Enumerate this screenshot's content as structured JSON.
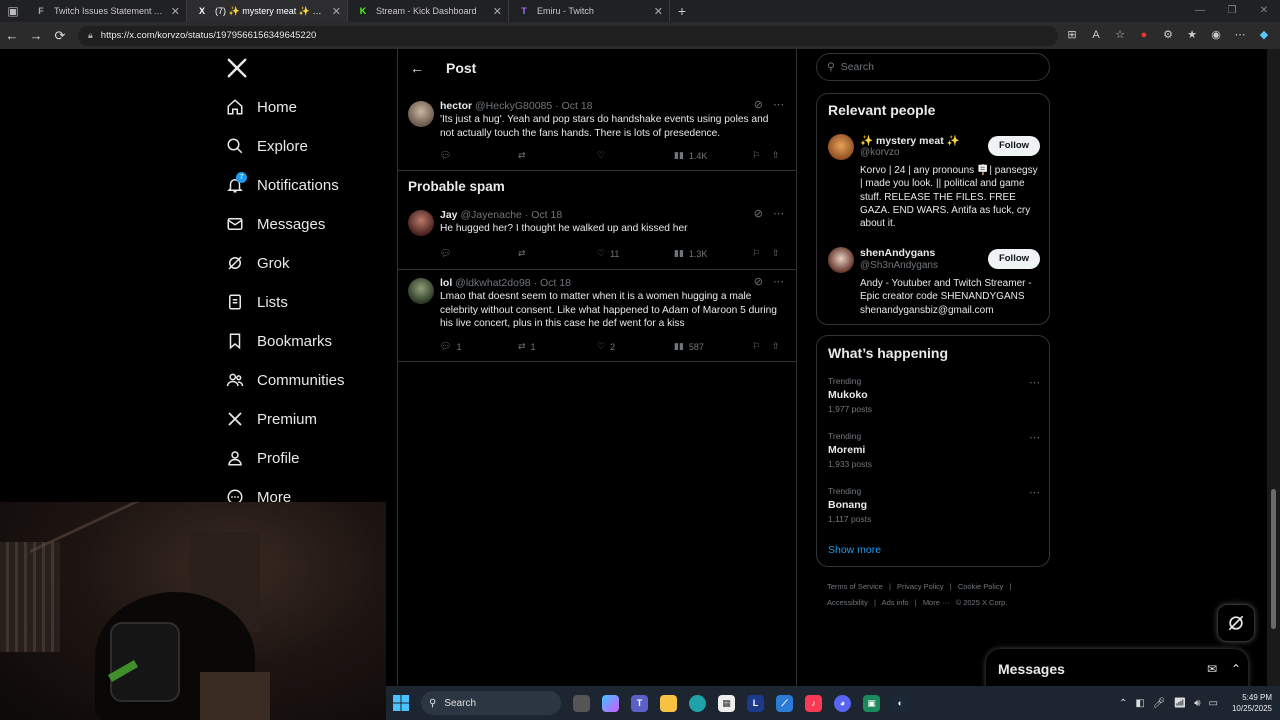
{
  "browser": {
    "tabs": [
      {
        "title": "Twitch Issues Statement After Emi",
        "favicon": "F",
        "active": false
      },
      {
        "title": "(7) ✨ mystery meat ✨ on X: \"@",
        "favicon": "X",
        "active": true
      },
      {
        "title": "Stream - Kick Dashboard",
        "favicon": "K",
        "active": false
      },
      {
        "title": "Emiru - Twitch",
        "favicon": "T",
        "active": false
      }
    ],
    "url": "https://x.com/korvzo/status/1979566156349645220"
  },
  "nav": {
    "items": [
      {
        "label": "Home",
        "icon": "home-icon"
      },
      {
        "label": "Explore",
        "icon": "search-icon"
      },
      {
        "label": "Notifications",
        "icon": "bell-icon",
        "badge": "7"
      },
      {
        "label": "Messages",
        "icon": "envelope-icon"
      },
      {
        "label": "Grok",
        "icon": "grok-icon"
      },
      {
        "label": "Lists",
        "icon": "list-icon"
      },
      {
        "label": "Bookmarks",
        "icon": "bookmark-icon"
      },
      {
        "label": "Communities",
        "icon": "people-icon"
      },
      {
        "label": "Premium",
        "icon": "x-icon"
      },
      {
        "label": "Profile",
        "icon": "person-icon"
      },
      {
        "label": "More",
        "icon": "more-circle-icon"
      }
    ]
  },
  "header": {
    "title": "Post"
  },
  "replies": [
    {
      "name": "hector",
      "handle": "@HeckyG80085",
      "date": "Oct 18",
      "text": "'Its just a hug'. Yeah and pop stars do handshake events using poles and not actually touch the fans hands. There is lots of presedence.",
      "replies": "",
      "reposts": "",
      "likes": "",
      "views": "1.4K"
    }
  ],
  "spam_section": {
    "title": "Probable spam",
    "posts": [
      {
        "name": "Jay",
        "handle": "@Jayenache",
        "date": "Oct 18",
        "text": "He hugged her? I thought he walked up and kissed her",
        "replies": "",
        "reposts": "",
        "likes": "11",
        "views": "1.3K"
      },
      {
        "name": "lol",
        "handle": "@ldkwhat2do98",
        "date": "Oct 18",
        "text": "Lmao that doesnt seem to matter when it is a women hugging a male celebrity without consent. Like what happened to Adam of Maroon 5 during his live concert, plus in this case he def went for a kiss",
        "replies": "1",
        "reposts": "1",
        "likes": "2",
        "views": "587"
      }
    ]
  },
  "search": {
    "placeholder": "Search"
  },
  "relevant_people": {
    "title": "Relevant people",
    "people": [
      {
        "name": "✨ mystery meat ✨",
        "handle": "@korvzo",
        "follow": "Follow",
        "bio": "Korvo | 24 | any pronouns 🪧| pansegsy | made you look. || political and game stuff. RELEASE THE FILES. FREE GAZA. END WARS. Antifa as fuck, cry about it."
      },
      {
        "name": "shenAndygans",
        "handle": "@Sh3nAndygans",
        "follow": "Follow",
        "bio": "Andy - Youtuber and Twitch Streamer - Epic creator code SHENANDYGANS shenandygansbiz@gmail.com"
      }
    ]
  },
  "whats_happening": {
    "title": "What’s happening",
    "trends": [
      {
        "label": "Trending",
        "name": "Mukoko",
        "count": "1,977 posts"
      },
      {
        "label": "Trending",
        "name": "Moremi",
        "count": "1,933 posts"
      },
      {
        "label": "Trending",
        "name": "Bonang",
        "count": "1,117 posts"
      }
    ],
    "show_more": "Show more"
  },
  "footer": {
    "links": [
      "Terms of Service",
      "|",
      "Privacy Policy",
      "|",
      "Cookie Policy",
      "|",
      "Accessibility",
      "|",
      "Ads info",
      "|",
      "More ···",
      "© 2025 X Corp."
    ]
  },
  "messages_drawer": {
    "title": "Messages"
  },
  "taskbar": {
    "search": "Search",
    "time": "5:49 PM",
    "date": "10/25/2025"
  },
  "colors": {
    "accent": "#1d9bf0",
    "background": "#000000",
    "border": "#2f3336",
    "muted": "#71767b"
  }
}
